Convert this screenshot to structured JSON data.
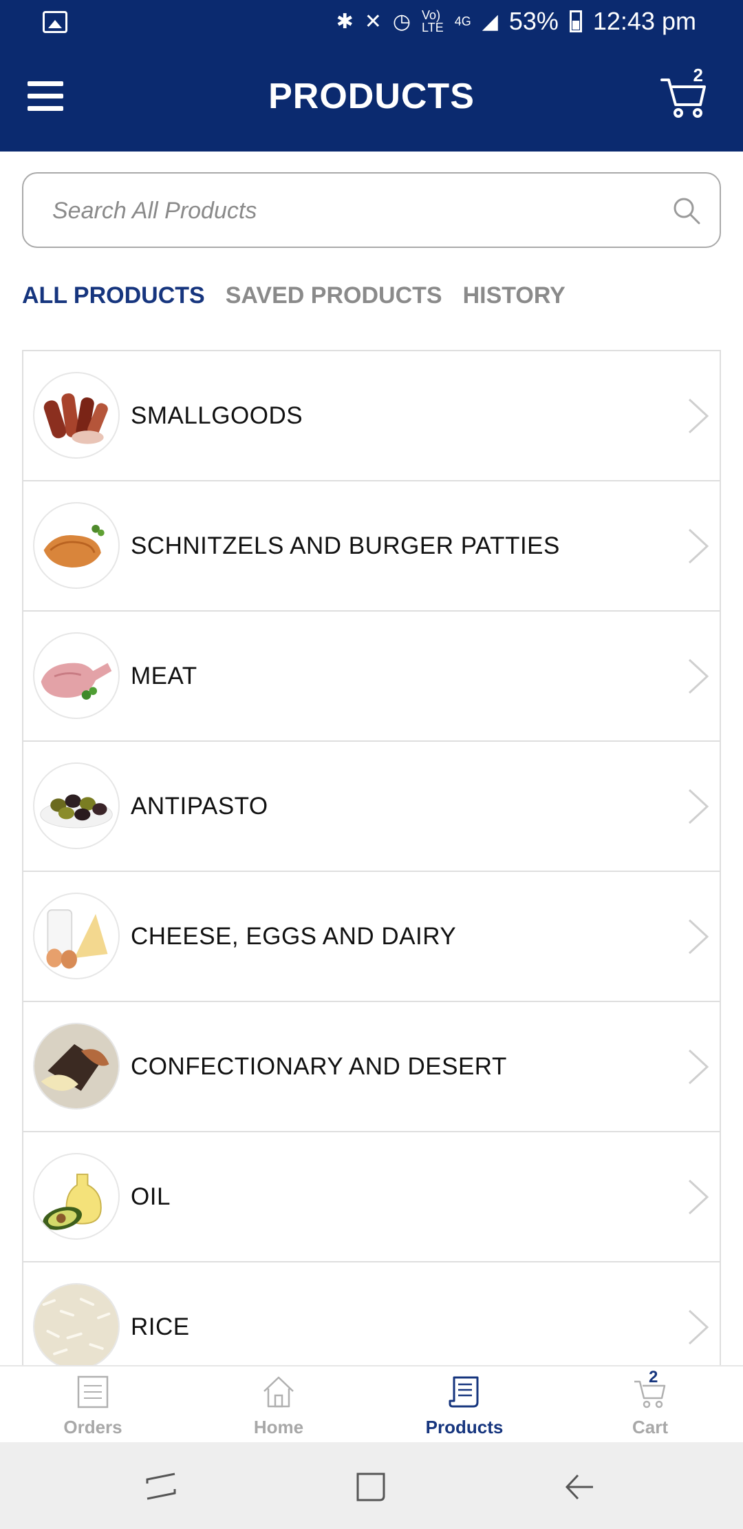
{
  "status_bar": {
    "battery": "53%",
    "time": "12:43 pm",
    "icons": [
      "image-icon",
      "bluetooth-icon",
      "vibrate-icon",
      "alarm-icon",
      "volte-icon",
      "4g-icon",
      "signal-icon",
      "battery-icon"
    ]
  },
  "header": {
    "title": "PRODUCTS",
    "cart_count": "2"
  },
  "search": {
    "placeholder": "Search All Products"
  },
  "tabs": [
    {
      "label": "ALL PRODUCTS",
      "active": true
    },
    {
      "label": "SAVED PRODUCTS",
      "active": false
    },
    {
      "label": "HISTORY",
      "active": false
    }
  ],
  "categories": [
    {
      "label": "SMALLGOODS",
      "thumb": "sausages"
    },
    {
      "label": "SCHNITZELS AND BURGER PATTIES",
      "thumb": "schnitzel"
    },
    {
      "label": "MEAT",
      "thumb": "meat"
    },
    {
      "label": "ANTIPASTO",
      "thumb": "olives"
    },
    {
      "label": "CHEESE, EGGS AND DAIRY",
      "thumb": "dairy"
    },
    {
      "label": "CONFECTIONARY AND DESERT",
      "thumb": "dessert"
    },
    {
      "label": "OIL",
      "thumb": "oil"
    },
    {
      "label": "RICE",
      "thumb": "rice"
    }
  ],
  "bottom_nav": [
    {
      "label": "Orders",
      "icon": "orders-icon",
      "active": false
    },
    {
      "label": "Home",
      "icon": "home-icon",
      "active": false
    },
    {
      "label": "Products",
      "icon": "products-icon",
      "active": true
    },
    {
      "label": "Cart",
      "icon": "cart-icon",
      "active": false,
      "badge": "2"
    }
  ],
  "colors": {
    "brand": "#0b2a6f",
    "active_tab": "#16357e",
    "inactive": "#8a8a8a"
  }
}
